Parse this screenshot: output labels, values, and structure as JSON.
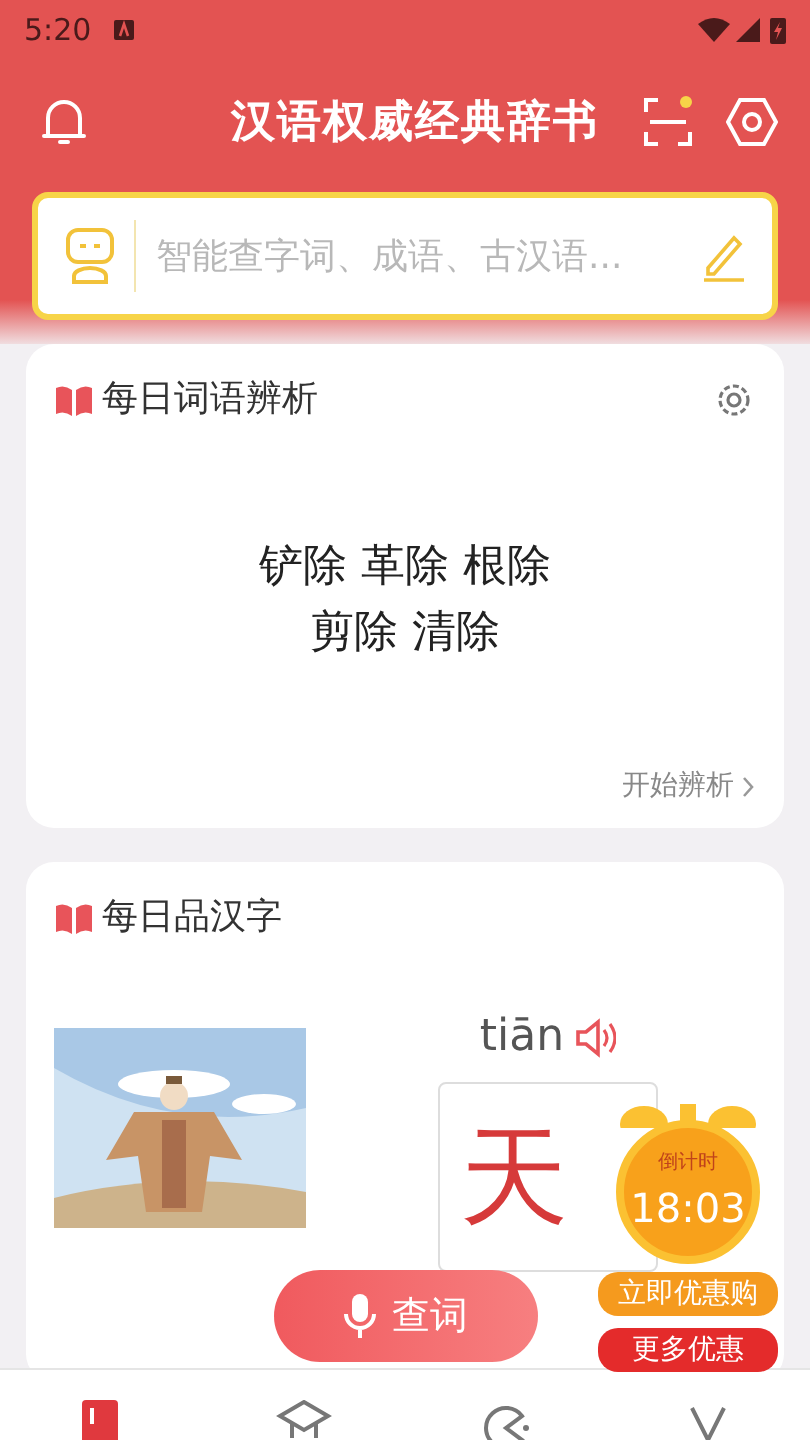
{
  "status_bar": {
    "time": "5:20"
  },
  "header": {
    "title": "汉语权威经典辞书"
  },
  "search": {
    "placeholder": "智能查字词、成语、古汉语..."
  },
  "word_card": {
    "title": "每日词语辨析",
    "lines": [
      "铲除 革除 根除",
      "剪除 清除"
    ],
    "link": "开始辨析"
  },
  "char_card": {
    "title": "每日品汉字",
    "pinyin": "tiān",
    "character": "天"
  },
  "lookup_button": {
    "label": "查词"
  },
  "promo": {
    "label": "倒计时",
    "time": "18:03",
    "buttons": [
      "立即优惠购",
      "更多优惠"
    ]
  },
  "bottom_nav": [
    {
      "selected": true
    },
    {
      "selected": false
    },
    {
      "selected": false
    },
    {
      "selected": false
    }
  ]
}
